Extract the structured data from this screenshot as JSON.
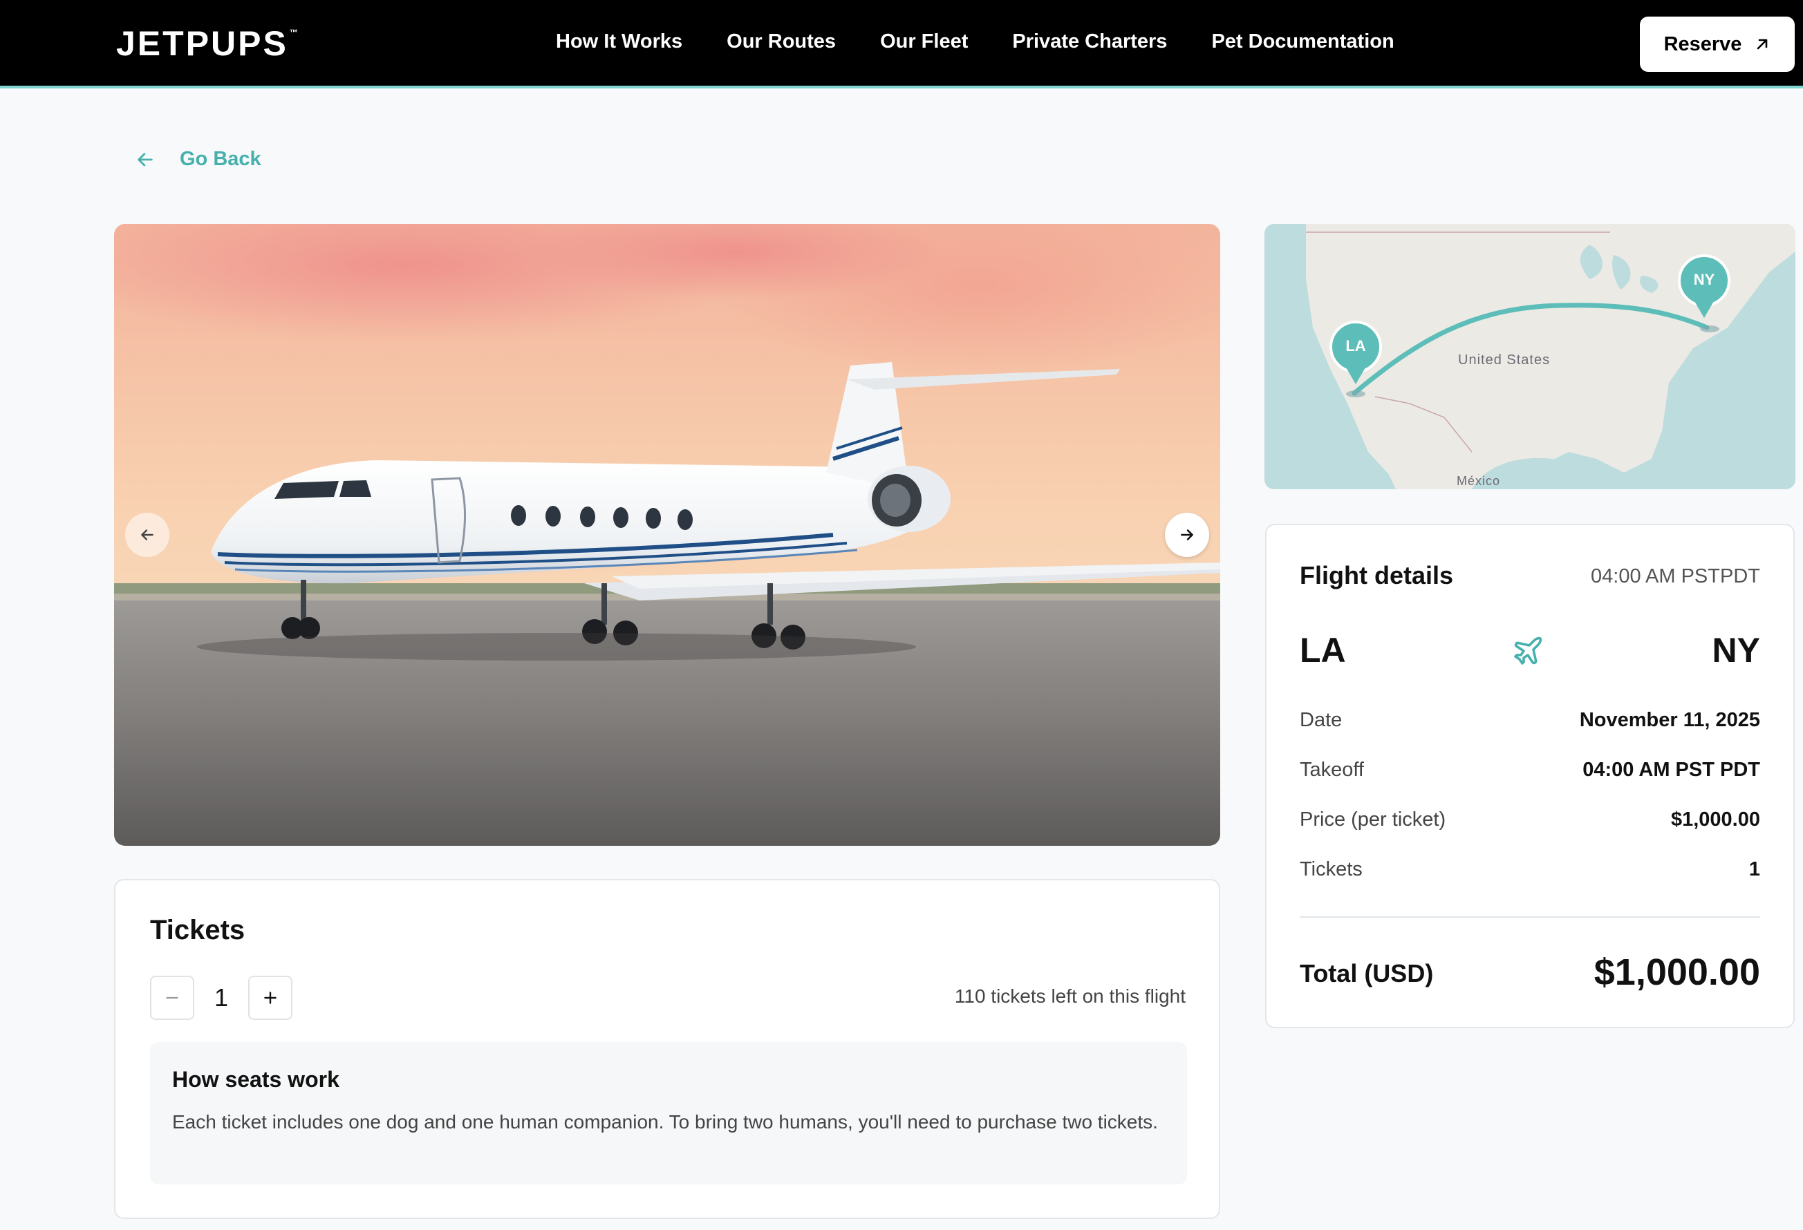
{
  "header": {
    "logo": "JETPUPS",
    "logo_tm": "™",
    "nav": [
      "How It Works",
      "Our Routes",
      "Our Fleet",
      "Private Charters",
      "Pet Documentation"
    ],
    "reserve_label": "Reserve",
    "reserve_icon": "arrow-up-right-icon"
  },
  "go_back": {
    "label": "Go Back",
    "icon": "arrow-left-icon"
  },
  "gallery": {
    "prev_icon": "arrow-left-icon",
    "next_icon": "arrow-right-icon"
  },
  "tickets": {
    "title": "Tickets",
    "quantity": "1",
    "remaining": "110 tickets left on this flight",
    "info_title": "How seats work",
    "info_text": "Each ticket includes one dog and one human companion. To bring two humans, you'll need to purchase two tickets."
  },
  "map": {
    "origin_marker": "LA",
    "destination_marker": "NY",
    "country_label": "United States",
    "mexico_label": "México",
    "accent": "#5dbdb8"
  },
  "flight_details": {
    "title": "Flight details",
    "time": "04:00 AM PSTPDT",
    "from": "LA",
    "to": "NY",
    "rows": [
      {
        "label": "Date",
        "value": "November 11, 2025"
      },
      {
        "label": "Takeoff",
        "value": "04:00 AM PST PDT"
      },
      {
        "label": "Price (per ticket)",
        "value": "$1,000.00"
      },
      {
        "label": "Tickets",
        "value": "1"
      }
    ],
    "total_label": "Total (USD)",
    "total_value": "$1,000.00"
  },
  "colors": {
    "accent": "#46b1ac",
    "header_bg": "#000000",
    "page_bg": "#f7f9fa"
  }
}
